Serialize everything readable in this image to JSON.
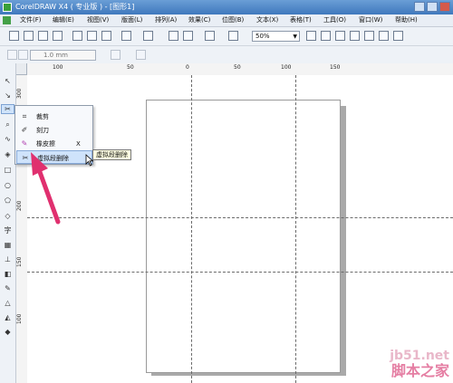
{
  "window": {
    "title": "CorelDRAW X4 ( 专业版 ) - [图形1]"
  },
  "menu": [
    {
      "label": "文件(F)"
    },
    {
      "label": "编辑(E)"
    },
    {
      "label": "视图(V)"
    },
    {
      "label": "版面(L)"
    },
    {
      "label": "排列(A)"
    },
    {
      "label": "效果(C)"
    },
    {
      "label": "位图(B)"
    },
    {
      "label": "文本(X)"
    },
    {
      "label": "表格(T)"
    },
    {
      "label": "工具(O)"
    },
    {
      "label": "窗口(W)"
    },
    {
      "label": "帮助(H)"
    }
  ],
  "toolbar": {
    "zoom_value": "50%"
  },
  "property_bar": {
    "nudge_value": "1.0 mm"
  },
  "ruler": {
    "horizontal_labels": [
      "100",
      "50",
      "0",
      "50",
      "100",
      "150"
    ],
    "vertical_labels": [
      "300",
      "250",
      "200",
      "150",
      "100"
    ]
  },
  "flyout": {
    "items": [
      {
        "label": "裁剪",
        "icon": "crop-icon",
        "shortcut": ""
      },
      {
        "label": "刻刀",
        "icon": "knife-icon",
        "shortcut": ""
      },
      {
        "label": "橡皮擦",
        "icon": "eraser-icon",
        "shortcut": "X"
      },
      {
        "label": "虚拟段删除",
        "icon": "virtual-segment-delete-icon",
        "shortcut": ""
      }
    ],
    "tooltip": "虚拟段删除"
  },
  "watermark": {
    "line1": "jb51.net",
    "line2": "脚本之家"
  },
  "colors": {
    "accent": "#3f78bd",
    "arrow": "#e0306f",
    "highlight": "#cfe3fb"
  }
}
